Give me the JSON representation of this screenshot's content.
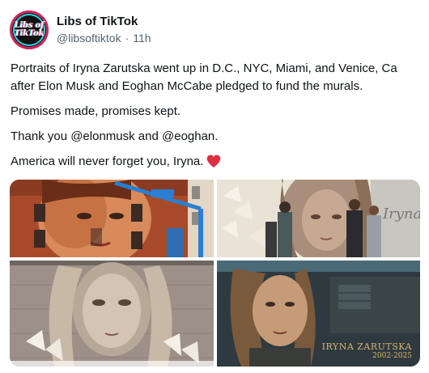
{
  "author": {
    "display_name": "Libs of TikTok",
    "handle": "@libsoftiktok",
    "separator": "·",
    "time": "11h",
    "avatar_logo": [
      "Libs of",
      "TikTok"
    ]
  },
  "post": {
    "paragraphs": [
      "Portraits of Iryna Zarutska went up in D.C., NYC, Miami, and Venice, Ca",
      "after Elon Musk and Eoghan McCabe pledged to fund the murals.",
      "Promises made, promises kept.",
      "Thank you @elonmusk and @eoghan.",
      "America will never forget you, Iryna."
    ],
    "emoji": "heart-icon"
  },
  "media": {
    "images": [
      {
        "name": "mural-nyc-building",
        "description_icon": "photo"
      },
      {
        "name": "mural-lilies-wall",
        "description_icon": "photo"
      },
      {
        "name": "mural-brick-wall",
        "description_icon": "photo"
      },
      {
        "name": "mural-night-street",
        "description_icon": "photo"
      }
    ],
    "caption_name": "IRYNA ZARUTSKA",
    "caption_years": "2002-2025"
  },
  "colors": {
    "text": "#0f1419",
    "secondary": "#536471",
    "heart": "#e0245e",
    "caption_gold": "#d9b26b"
  }
}
